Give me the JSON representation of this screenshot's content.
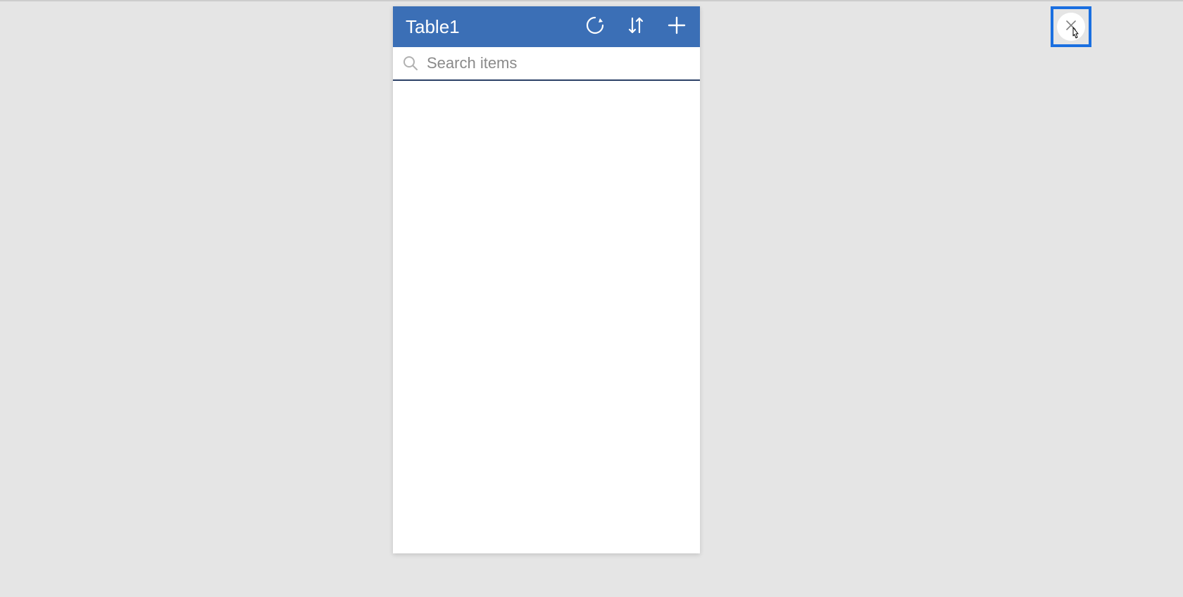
{
  "header": {
    "title": "Table1",
    "icons": {
      "refresh": "refresh-icon",
      "sort": "sort-icon",
      "add": "plus-icon"
    }
  },
  "search": {
    "placeholder": "Search items",
    "value": ""
  },
  "colors": {
    "header_bg": "#3b6fb6",
    "header_text": "#ffffff",
    "accent": "#1a6fe0",
    "search_underline": "#2a3f66",
    "placeholder": "#8a8a8a",
    "page_bg": "#e5e5e5"
  },
  "close_button": {
    "highlighted": true
  },
  "list": {
    "items": []
  }
}
